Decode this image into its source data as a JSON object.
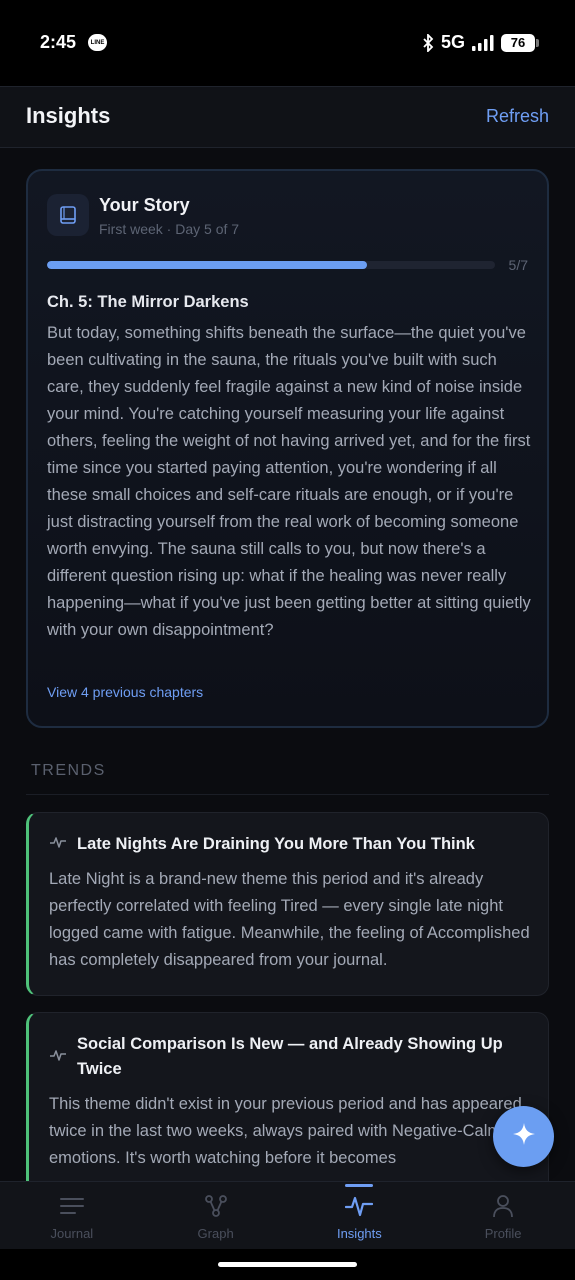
{
  "status_bar": {
    "time": "2:45",
    "notification_badge": "LINE",
    "network": "5G",
    "battery": "76"
  },
  "header": {
    "title": "Insights",
    "refresh_label": "Refresh"
  },
  "story": {
    "title": "Your Story",
    "subtitle": "First week · Day 5 of 7",
    "progress_label": "5/7",
    "progress_fraction": 0.714,
    "chapter_title": "Ch. 5: The Mirror Darkens",
    "chapter_text": "But today, something shifts beneath the surface—the quiet you've been cultivating in the sauna, the rituals you've built with such care, they suddenly feel fragile against a new kind of noise inside your mind. You're catching yourself measuring your life against others, feeling the weight of not having arrived yet, and for the first time since you started paying attention, you're wondering if all these small choices and self-care rituals are enough, or if you're just distracting yourself from the real work of becoming someone worth envying. The sauna still calls to you, but now there's a different question rising up: what if the healing was never really happening—what if you've just been getting better at sitting quietly with your own disappointment?",
    "previous_link": "View 4 previous chapters"
  },
  "trends": {
    "header": "TRENDS",
    "items": [
      {
        "title": "Late Nights Are Draining You More Than You Think",
        "body": "Late Night is a brand-new theme this period and it's already perfectly correlated with feeling Tired — every single late night logged came with fatigue. Meanwhile, the feeling of Accomplished has completely disappeared from your journal."
      },
      {
        "title": "Social Comparison Is New — and Already Showing Up Twice",
        "body": "This theme didn't exist in your previous period and has appeared twice in the last two weeks, always paired with Negative-Calm emotions. It's worth watching before it becomes"
      }
    ]
  },
  "nav": {
    "items": [
      {
        "label": "Journal",
        "icon": "journal-icon"
      },
      {
        "label": "Graph",
        "icon": "graph-icon"
      },
      {
        "label": "Insights",
        "icon": "insights-icon",
        "active": true
      },
      {
        "label": "Profile",
        "icon": "profile-icon"
      }
    ]
  },
  "colors": {
    "accent": "#6f9ef4",
    "trend_border": "#4fc27a",
    "background": "#0b0c10"
  }
}
